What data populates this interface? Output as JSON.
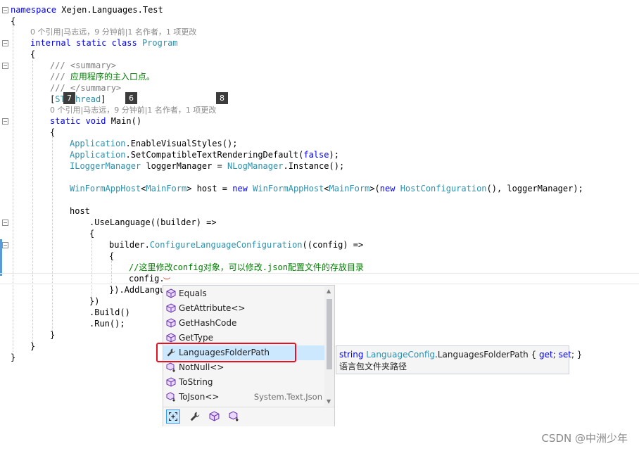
{
  "code": {
    "ns_kw": "namespace",
    "ns_name": " Xejen.Languages.Test",
    "brace_open": "{",
    "brace_close": "}",
    "lens_class": "0 个引用|马志远，9 分钟前|1 名作者，1 项更改",
    "class_mod": "internal static class",
    "class_name": "Program",
    "doc1_pre": "/// ",
    "doc1_tag": "<summary>",
    "doc2_pre": "/// ",
    "doc2_text": "应用程序的主入口点。",
    "doc3_pre": "/// ",
    "doc3_tag": "</summary>",
    "attr_open": "[",
    "attr_name": "STAThread",
    "attr_close": "]",
    "lens_main": "0 个引用|马志远，9 分钟前|1 名作者，1 项更改",
    "main_mod": "static void",
    "main_name": " Main()",
    "l1_type": "Application",
    "l1_rest": ".EnableVisualStyles();",
    "l2_type": "Application",
    "l2_rest_a": ".SetCompatibleTextRenderingDefault(",
    "l2_false": "false",
    "l2_rest_b": ");",
    "l3_type": "ILoggerManager",
    "l3_rest_a": " loggerManager = ",
    "l3_type2": "NLogManager",
    "l3_rest_b": ".Instance();",
    "l4_type": "WinFormAppHost",
    "l4_lt": "<",
    "l4_gen": "MainForm",
    "l4_gt": ">",
    "l4_host": " host = ",
    "l4_new": "new",
    "l4_sp": " ",
    "l4_type2": "WinFormAppHost",
    "l4_lt2": "<",
    "l4_gen2": "MainForm",
    "l4_gt2": ">(",
    "l4_new2": "new",
    "l4_sp2": " ",
    "l4_type3": "HostConfiguration",
    "l4_end": "(), loggerManager);",
    "l5": "host",
    "l6": ".UseLanguage((builder) =>",
    "l7": "{",
    "l8_a": "builder.",
    "l8_b": "ConfigureLanguageConfiguration",
    "l8_c": "((config) =>",
    "l9": "{",
    "l10": "//这里修改config对象，可以修改.json配置文件的存放目录",
    "l11": "config.",
    "l12": "}).AddLangu",
    "l13": "})",
    "l14": ".Build()",
    "l15": ".Run();",
    "fold_minus": "−"
  },
  "badges": [
    "7",
    "6",
    "8"
  ],
  "completion": {
    "items": [
      {
        "label": "Equals",
        "icon": "method-icon"
      },
      {
        "label": "GetAttribute<>",
        "icon": "method-icon"
      },
      {
        "label": "GetHashCode",
        "icon": "method-icon"
      },
      {
        "label": "GetType",
        "icon": "method-icon"
      },
      {
        "label": "LanguagesFolderPath",
        "icon": "wrench-property-icon",
        "selected": true
      },
      {
        "label": "NotNull<>",
        "icon": "extension-method-icon"
      },
      {
        "label": "ToString",
        "icon": "method-icon"
      },
      {
        "label": "ToJson<>",
        "icon": "extension-method-icon",
        "hint": "System.Text.Json"
      }
    ],
    "scroll_up": "▲",
    "scroll_down": "▼",
    "filters": [
      "expand-filter-icon",
      "properties-filter-icon",
      "methods-filter-icon",
      "extension-methods-filter-icon"
    ]
  },
  "tooltip": {
    "type_kw": "string",
    "class_name": "LanguageConfig",
    "member": ".LanguagesFolderPath { ",
    "get": "get",
    "semi1": "; ",
    "set": "set",
    "end": "; }",
    "description": "语言包文件夹路径"
  },
  "watermark": "CSDN @中洲少年",
  "colors": {
    "keyword": "#0000ff",
    "type": "#2b91af",
    "comment": "#008000",
    "selection": "#cce8ff",
    "highlight_box": "#e81123"
  }
}
